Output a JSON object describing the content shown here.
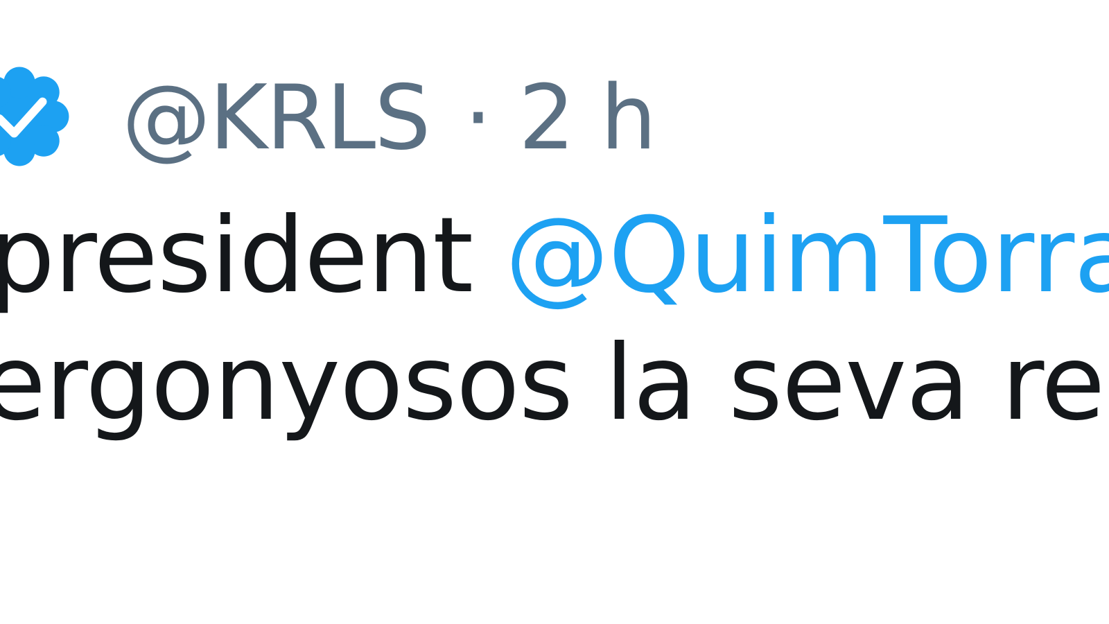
{
  "tweet": {
    "verified_icon": "verified-badge-icon",
    "handle": "@KRLS",
    "separator": "·",
    "time": "2 h",
    "line1_prefix": "president ",
    "mention": "@QuimTorraiPla",
    "line2": "ergonyosos la seva relació"
  },
  "colors": {
    "verified": "#1da1f2",
    "meta": "#5b7083",
    "text": "#14171a",
    "link": "#1da1f2",
    "background": "#ffffff"
  }
}
